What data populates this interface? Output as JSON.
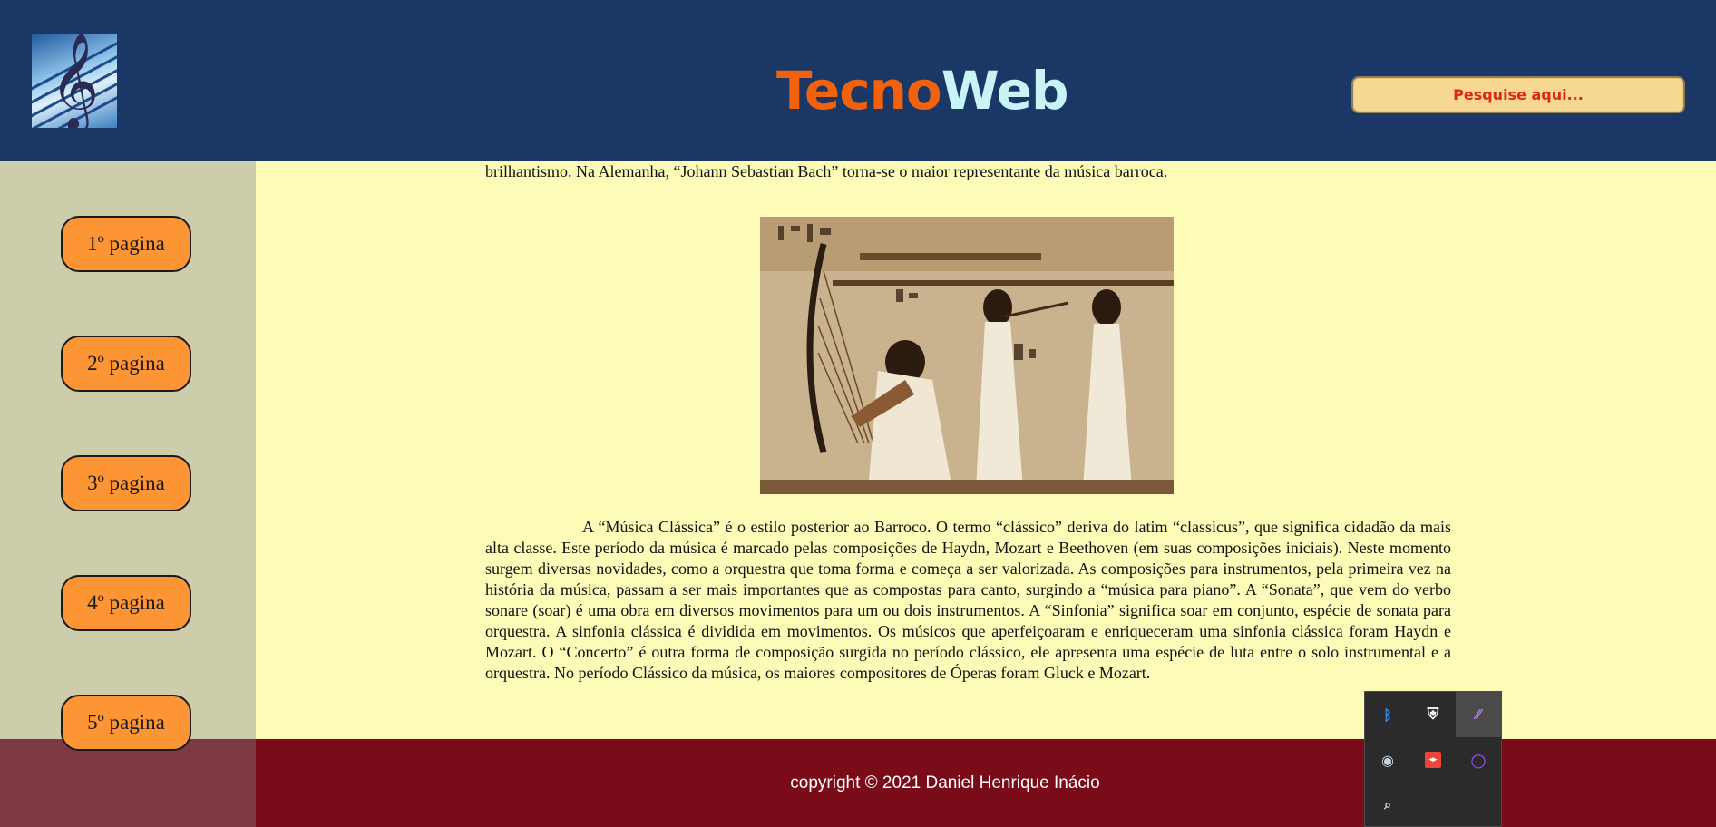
{
  "header": {
    "logo_icon": "treble-clef-icon",
    "brand_part1": "Tecno",
    "brand_part2": "Web",
    "search_placeholder": "Pesquise aqui...",
    "colors": {
      "bar": "#1b3766",
      "brand_orange": "#f2620d",
      "brand_cyan": "#c8f4f7",
      "search_bg": "#f7d893",
      "search_text": "#d9291a"
    }
  },
  "sidebar": {
    "items": [
      {
        "label": "1º pagina"
      },
      {
        "label": "2º pagina"
      },
      {
        "label": "3º pagina"
      },
      {
        "label": "4º pagina"
      },
      {
        "label": "5º pagina"
      }
    ],
    "colors": {
      "bg": "#cdcdab",
      "button": "#fe9535"
    }
  },
  "content": {
    "paragraph_top": "brilhantismo. Na Alemanha, “Johann Sebastian Bach” torna-se o maior representante da música barroca.",
    "image_icon": "egyptian-musicians-painting",
    "paragraph_main": "A “Música Clássica” é o estilo posterior ao Barroco. O termo “clássico” deriva do latim “classicus”, que significa cidadão da mais alta classe. Este período da música é marcado pelas composições de Haydn, Mozart e Beethoven (em suas composições iniciais). Neste momento surgem diversas novidades, como a orquestra que toma forma e começa a ser valorizada. As composições para instrumentos, pela primeira vez na história da música, passam a ser mais importantes que as compostas para canto, surgindo a “música para piano”. A “Sonata”, que vem do verbo sonare (soar) é uma obra em diversos movimentos para um ou dois instrumentos. A “Sinfonia” significa soar em conjunto, espécie de sonata para orquestra. A sinfonia clássica é dividida em movimentos. Os músicos que aperfeiçoaram e enriqueceram uma sinfonia clássica foram Haydn e Mozart. O “Concerto” é outra forma de composição surgida no período clássico, ele apresenta uma espécie de luta entre o solo instrumental e a orquestra. No período Clássico da música, os maiores compositores de Óperas foram Gluck e Mozart.",
    "bg_color": "#fdfbb8"
  },
  "footer": {
    "copyright": "copyright © 2021 Daniel Henrique Inácio",
    "colors": {
      "bg": "#7a0c19",
      "left_block": "#7d3a45"
    }
  },
  "tray": {
    "icons": [
      {
        "name": "bluetooth-icon",
        "glyph": "ᛒ",
        "color": "#3a8ee6"
      },
      {
        "name": "security-shield-warning-icon",
        "glyph": "⛨",
        "color": "#ffffff"
      },
      {
        "name": "pen-feather-icon",
        "glyph": "⁄⁄",
        "color": "#b47cf0"
      },
      {
        "name": "steam-icon",
        "glyph": "◉",
        "color": "#c6d4df"
      },
      {
        "name": "anydesk-icon",
        "glyph": "◂▸",
        "color": "#ffffff"
      },
      {
        "name": "circle-app-icon",
        "glyph": "○",
        "color": "#9b4dff"
      },
      {
        "name": "magnifier-tool-icon",
        "glyph": "⌕",
        "color": "#e0e0e0"
      }
    ]
  }
}
